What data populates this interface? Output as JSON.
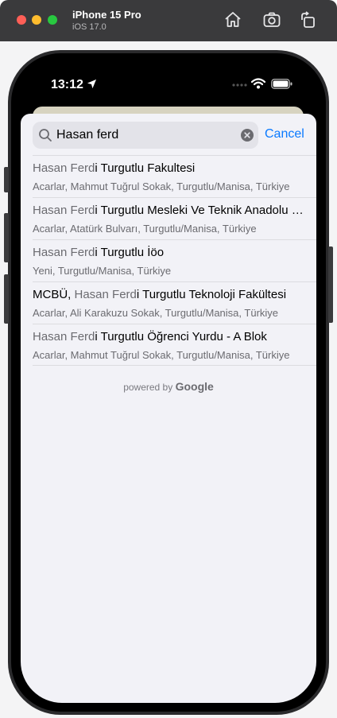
{
  "window": {
    "device_name": "iPhone 15 Pro",
    "os_version": "iOS 17.0",
    "toolbar_icons": [
      "home-icon",
      "screenshot-icon",
      "rotate-icon"
    ]
  },
  "status_bar": {
    "time": "13:12"
  },
  "search": {
    "value": "Hasan ferd",
    "cancel_label": "Cancel"
  },
  "results": [
    {
      "match": "Hasan Ferd",
      "rest": "i Turgutlu Fakultesi",
      "prefix": "",
      "subtitle": "Acarlar, Mahmut Tuğrul Sokak, Turgutlu/Manisa, Türkiye"
    },
    {
      "match": "Hasan Ferd",
      "rest": "i Turgutlu Mesleki Ve Teknik Anadolu Lisesi",
      "prefix": "",
      "subtitle": "Acarlar, Atatürk Bulvarı, Turgutlu/Manisa, Türkiye"
    },
    {
      "match": "Hasan Ferd",
      "rest": "i Turgutlu İöo",
      "prefix": "",
      "subtitle": "Yeni, Turgutlu/Manisa, Türkiye"
    },
    {
      "match": "Hasan Ferd",
      "rest": "i Turgutlu Teknoloji Fakültesi",
      "prefix": "MCBÜ, ",
      "subtitle": "Acarlar, Ali Karakuzu Sokak, Turgutlu/Manisa, Türkiye"
    },
    {
      "match": "Hasan Ferd",
      "rest": "i Turgutlu Öğrenci Yurdu - A Blok",
      "prefix": "",
      "subtitle": "Acarlar, Mahmut Tuğrul Sokak, Turgutlu/Manisa, Türkiye"
    }
  ],
  "attribution": {
    "prefix": "powered by",
    "brand": "Google"
  },
  "colors": {
    "accent": "#0a7aff",
    "sheet_bg": "#f2f2f7",
    "toolbar_bg": "#3a3a3c"
  }
}
